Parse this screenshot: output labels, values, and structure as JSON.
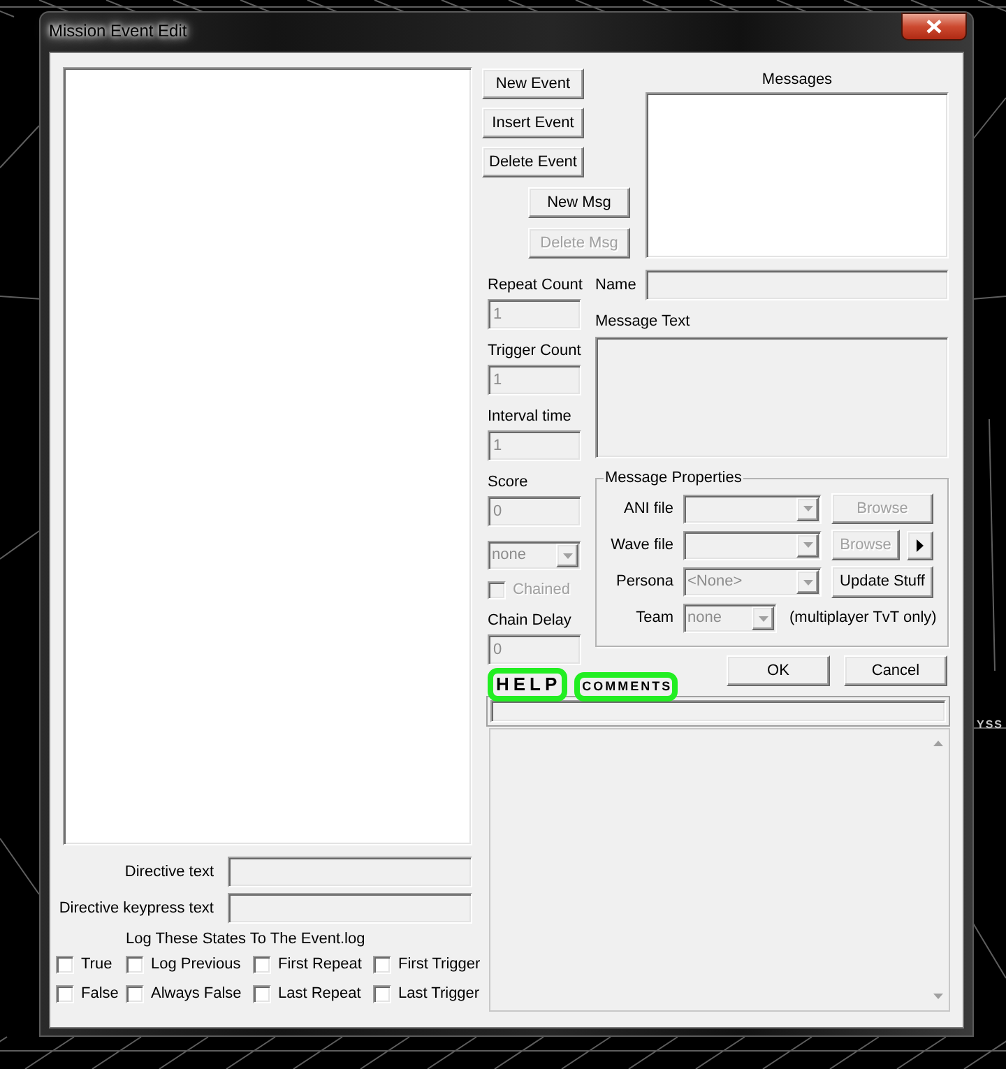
{
  "window": {
    "title": "Mission Event Edit"
  },
  "background_text": "YSS",
  "directive_fields": [
    {
      "label": "Directive text",
      "disabled": true
    },
    {
      "label": "Directive keypress text",
      "disabled": true
    }
  ],
  "log_states": {
    "title": "Log These States To The Event.log",
    "options": [
      {
        "label": "True",
        "checked": false
      },
      {
        "label": "Log Previous",
        "checked": false
      },
      {
        "label": "First Repeat",
        "checked": false
      },
      {
        "label": "First Trigger",
        "checked": false
      },
      {
        "label": "False",
        "checked": false
      },
      {
        "label": "Always False",
        "checked": false
      },
      {
        "label": "Last Repeat",
        "checked": false
      },
      {
        "label": "Last Trigger",
        "checked": false
      }
    ]
  },
  "event_buttons": [
    {
      "label": "New Event",
      "disabled": false
    },
    {
      "label": "Insert Event",
      "disabled": false
    },
    {
      "label": "Delete Event",
      "disabled": false
    }
  ],
  "message_buttons": [
    {
      "label": "New Msg",
      "disabled": false
    },
    {
      "label": "Delete Msg",
      "disabled": true
    }
  ],
  "messages": {
    "title": "Messages"
  },
  "event_fields": [
    {
      "kind": "field",
      "label": "Repeat Count",
      "value": "1",
      "disabled": true
    },
    {
      "kind": "field",
      "label": "Trigger Count",
      "value": "1",
      "disabled": true
    },
    {
      "kind": "field",
      "label": "Interval time",
      "value": "1",
      "disabled": true
    },
    {
      "kind": "field",
      "label": "Score",
      "value": "0",
      "disabled": true
    },
    {
      "kind": "dropdown",
      "value": "none",
      "disabled": true
    },
    {
      "kind": "checkbox",
      "label": "Chained",
      "checked": false,
      "disabled": true
    },
    {
      "kind": "field",
      "label": "Chain Delay",
      "value": "0",
      "disabled": true
    }
  ],
  "message": {
    "name": {
      "label": "Name",
      "disabled": true
    },
    "text": {
      "label": "Message Text",
      "disabled": true
    }
  },
  "message_properties": {
    "title": "Message Properties",
    "rows": [
      {
        "label": "ANI file",
        "disabled": true,
        "button": {
          "label": "Browse",
          "disabled": true
        }
      },
      {
        "label": "Wave file",
        "disabled": true,
        "button": {
          "label": "Browse",
          "disabled": true
        },
        "play_button": {
          "disabled": false
        }
      },
      {
        "label": "Persona",
        "value": "<None>",
        "disabled": true,
        "button": {
          "label": "Update Stuff",
          "disabled": false
        }
      },
      {
        "label": "Team",
        "value": "none",
        "disabled": true,
        "note": "(multiplayer TvT only)"
      }
    ]
  },
  "dialog_buttons": [
    {
      "label": "OK",
      "disabled": false
    },
    {
      "label": "Cancel",
      "disabled": false
    }
  ],
  "tabs": [
    {
      "label": "HELP",
      "selected": true,
      "highlighted": true
    },
    {
      "label": "COMMENTS",
      "selected": false,
      "highlighted": true
    }
  ]
}
